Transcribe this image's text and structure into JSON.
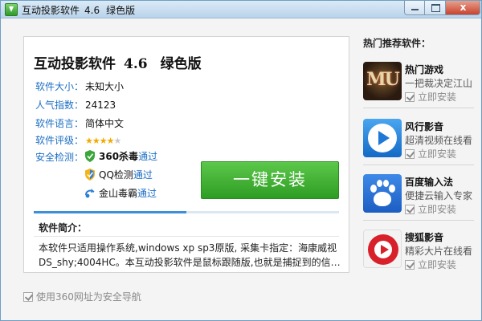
{
  "window": {
    "title": "互动投影软件",
    "version": "4.6",
    "edition": "绿色版",
    "close_glyph": "x"
  },
  "software": {
    "name": "互动投影软件",
    "version": "4.6",
    "edition": "绿色版",
    "info": [
      {
        "label": "软件大小：",
        "value": "未知大小"
      },
      {
        "label": "人气指数：",
        "value": "24123"
      },
      {
        "label": "软件语言：",
        "value": "简体中文"
      },
      {
        "label": "软件评级：",
        "rating": 4,
        "rating_max": 5
      }
    ],
    "security_label": "安全检测：",
    "security_checks": [
      {
        "engine": "360杀毒",
        "result": "通过",
        "icon": "360-shield-icon"
      },
      {
        "engine": "QQ检测",
        "result": "通过",
        "icon": "qq-shield-icon"
      },
      {
        "engine": "金山毒霸",
        "result": "通过",
        "icon": "kingsoft-icon"
      }
    ],
    "star_glyph": "★",
    "install_button": "一键安装",
    "progress_fraction": 0.5,
    "intro_title": "软件简介：",
    "intro_lines": [
      "本软件只适用操作系统,windows xp sp3原版, 采集卡指定：海康威视",
      "DS_shy;4004HC。本互动投影软件是鼠标跟随版,也就是捕捉到的信息..."
    ]
  },
  "footer": {
    "checkbox_label": "使用360网址为安全导航",
    "checked": true
  },
  "sidebar": {
    "title": "热门推荐软件：",
    "items": [
      {
        "name": "热门游戏",
        "desc": "一把裁决定江山",
        "install": "立即安装",
        "icon": "mu-game-icon",
        "checked": true
      },
      {
        "name": "风行影音",
        "desc": "超清视频在线看",
        "install": "立即安装",
        "icon": "funshion-video-icon",
        "checked": true
      },
      {
        "name": "百度输入法",
        "desc": "便捷云输入专家",
        "install": "立即安装",
        "icon": "baidu-paw-icon",
        "checked": true
      },
      {
        "name": "搜狐影音",
        "desc": "精彩大片在线看",
        "install": "立即安装",
        "icon": "sohu-video-icon",
        "checked": true
      }
    ],
    "game_logo_text": "MU"
  },
  "colors": {
    "accent_blue": "#1e6fc4",
    "install_green": "#3fae33",
    "star": "#f2a900",
    "close_red": "#c7432d"
  }
}
